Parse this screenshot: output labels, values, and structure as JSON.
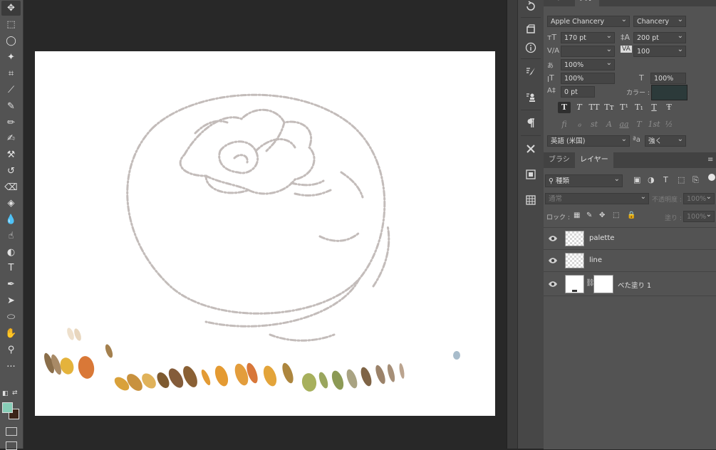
{
  "tools": [
    {
      "name": "move-tool",
      "glyph": "✥"
    },
    {
      "name": "marquee-tool",
      "glyph": "⬚"
    },
    {
      "name": "lasso-tool",
      "glyph": "◯"
    },
    {
      "name": "magic-wand-tool",
      "glyph": "✦"
    },
    {
      "name": "crop-tool",
      "glyph": "⌗"
    },
    {
      "name": "eyedropper-tool",
      "glyph": "⟋"
    },
    {
      "name": "brush-tool",
      "glyph": "✎"
    },
    {
      "name": "pencil-tool",
      "glyph": "✏"
    },
    {
      "name": "mixer-brush-tool",
      "glyph": "✍"
    },
    {
      "name": "clone-stamp-tool",
      "glyph": "⚒"
    },
    {
      "name": "history-brush-tool",
      "glyph": "↺"
    },
    {
      "name": "eraser-tool",
      "glyph": "⌫"
    },
    {
      "name": "paint-bucket-tool",
      "glyph": "◈"
    },
    {
      "name": "blur-tool",
      "glyph": "💧"
    },
    {
      "name": "smudge-tool",
      "glyph": "☝"
    },
    {
      "name": "dodge-tool",
      "glyph": "◐"
    },
    {
      "name": "type-tool",
      "glyph": "T"
    },
    {
      "name": "pen-tool",
      "glyph": "✒"
    },
    {
      "name": "path-selection-tool",
      "glyph": "➤"
    },
    {
      "name": "ellipse-tool",
      "glyph": "⬭"
    },
    {
      "name": "hand-tool",
      "glyph": "✋"
    },
    {
      "name": "zoom-tool",
      "glyph": "⚲"
    },
    {
      "name": "more-tools",
      "glyph": "···"
    }
  ],
  "colors": {
    "foreground": "#86cdb6",
    "background": "#3a2418",
    "canvas": "#ffffff",
    "color_swatch": "#2c3a3a"
  },
  "character_panel": {
    "tabs": [
      "カラー",
      "文字"
    ],
    "font_family": "Apple Chancery",
    "font_style": "Chancery",
    "font_size": "170 pt",
    "leading": "200 pt",
    "kerning": "",
    "tracking": "100",
    "tsume": "100%",
    "vertical_scale": "100%",
    "horizontal_scale": "100%",
    "baseline_shift": "0 pt",
    "color_label": "カラー :",
    "style_buttons": [
      "T",
      "T",
      "TT",
      "Tт",
      "T¹",
      "T₁",
      "T",
      "Ŧ"
    ],
    "opentype_buttons": [
      "fi",
      "ℴ",
      "st",
      "A",
      "aa",
      "T",
      "1st",
      "½"
    ],
    "language": "英語 (米国)",
    "antialias_icon": "ªa",
    "antialias": "強く"
  },
  "layers_panel": {
    "tabs": [
      "ブラシ",
      "レイヤー"
    ],
    "filter_kind": "種類",
    "blend_mode": "通常",
    "opacity_label": "不透明度 :",
    "opacity": "100%",
    "lock_label": "ロック :",
    "fill_label": "塗り :",
    "fill": "100%",
    "layers": [
      {
        "name": "palette"
      },
      {
        "name": "line"
      },
      {
        "name": "べた塗り 1"
      }
    ]
  }
}
